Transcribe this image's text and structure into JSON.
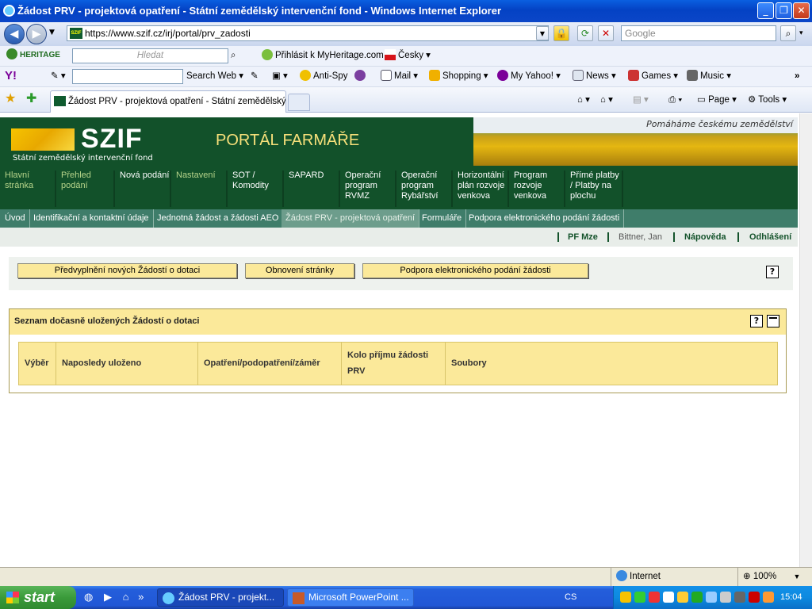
{
  "window": {
    "title": "Žádost PRV - projektová opatření - Státní zemědělský intervenční fond - Windows Internet Explorer"
  },
  "address": {
    "url": "https://www.szif.cz/irj/portal/prv_zadosti",
    "search_placeholder": "Google"
  },
  "toolbar1": {
    "myheritage": "HERITAGE",
    "search_placeholder": "Hledat",
    "login": "Přihlásit k MyHeritage.com",
    "language": "Česky"
  },
  "toolbar2": {
    "search_web": "Search Web",
    "antispy": "Anti-Spy",
    "mail": "Mail",
    "shopping": "Shopping",
    "myyahoo": "My Yahoo!",
    "news": "News",
    "games": "Games",
    "music": "Music"
  },
  "tabs": {
    "active": "Žádost PRV - projektová opatření - Státní zemědělský ...",
    "page": "Page",
    "tools": "Tools"
  },
  "site": {
    "logo": "SZIF",
    "logo_sub": "Státní zemědělský intervenční fond",
    "portal": "PORTÁL FARMÁŘE",
    "slogan": "Pomáháme českému zemědělství",
    "nav": [
      {
        "label": "Hlavní\nstránka"
      },
      {
        "label": "Přehled\npodání"
      },
      {
        "label": "Nová podání"
      },
      {
        "label": "Nastavení"
      },
      {
        "label": "SOT /\nKomodity"
      },
      {
        "label": "SAPARD"
      },
      {
        "label": "Operační\nprogram\nRVMZ"
      },
      {
        "label": "Operační\nprogram\nRybářství"
      },
      {
        "label": "Horizontální\nplán rozvoje\nvenkova"
      },
      {
        "label": "Program\nrozvoje\nvenkova"
      },
      {
        "label": "Přímé platby\n/ Platby na\nplochu"
      }
    ],
    "subnav": [
      "Úvod",
      "Identifikační a kontaktní údaje",
      "Jednotná žádost a žádosti AEO",
      "Žádost PRV - projektová opatření",
      "Formuláře",
      "Podpora elektronického podání žádosti"
    ],
    "user": {
      "pfmze": "PF Mze",
      "name": "Bittner, Jan",
      "help": "Nápověda",
      "logout": "Odhlášení"
    },
    "actions": [
      "Předvyplnění nových Žádostí o dotaci",
      "Obnovení stránky",
      "Podpora elektronického podání žádosti"
    ],
    "help_symbol": "?",
    "panel": {
      "title": "Seznam dočasně uložených Žádostí o dotaci",
      "columns": [
        "Výběr",
        "Naposledy uloženo",
        "Opatření/podopatření/záměr",
        "Kolo příjmu žádosti\nPRV",
        "Soubory"
      ]
    }
  },
  "status": {
    "zone": "Internet",
    "zoom": "100%"
  },
  "taskbar": {
    "start": "start",
    "tasks": [
      "Žádost PRV - projekt...",
      "Microsoft PowerPoint ..."
    ],
    "lang": "CS",
    "clock": "15:04"
  }
}
